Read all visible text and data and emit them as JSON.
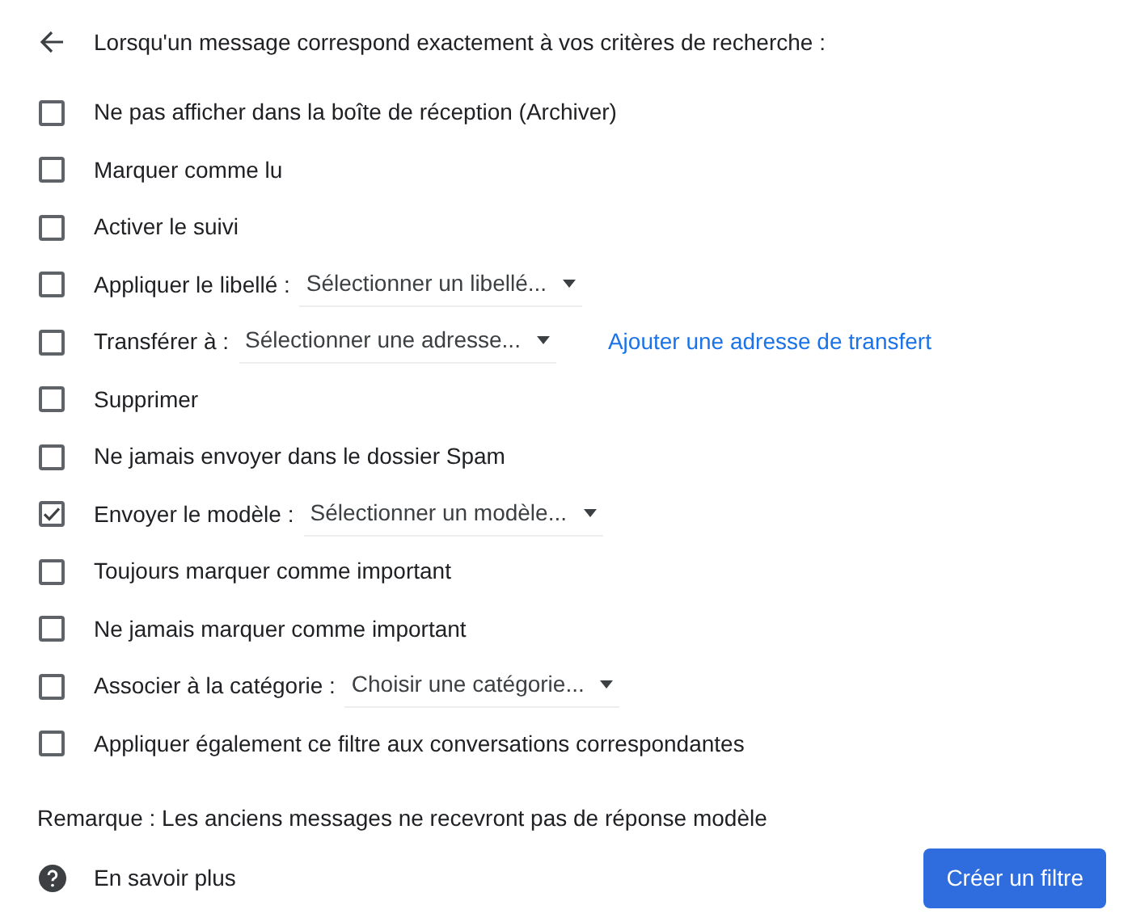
{
  "header": {
    "title": "Lorsqu'un message correspond exactement à vos critères de recherche :"
  },
  "options": [
    {
      "label": "Ne pas afficher dans la boîte de réception (Archiver)",
      "checked": false
    },
    {
      "label": "Marquer comme lu",
      "checked": false
    },
    {
      "label": "Activer le suivi",
      "checked": false
    },
    {
      "label": "Appliquer le libellé :",
      "checked": false,
      "dropdown": "Sélectionner un libellé..."
    },
    {
      "label": "Transférer à :",
      "checked": false,
      "dropdown": "Sélectionner une adresse...",
      "link": "Ajouter une adresse de transfert"
    },
    {
      "label": "Supprimer",
      "checked": false
    },
    {
      "label": "Ne jamais envoyer dans le dossier Spam",
      "checked": false
    },
    {
      "label": "Envoyer le modèle :",
      "checked": true,
      "dropdown": "Sélectionner un modèle..."
    },
    {
      "label": "Toujours marquer comme important",
      "checked": false
    },
    {
      "label": "Ne jamais marquer comme important",
      "checked": false
    },
    {
      "label": "Associer à la catégorie :",
      "checked": false,
      "dropdown": "Choisir une catégorie..."
    },
    {
      "label": "Appliquer également ce filtre aux conversations correspondantes",
      "checked": false
    }
  ],
  "note": "Remarque : Les anciens messages ne recevront pas de réponse modèle",
  "footer": {
    "help_link": "En savoir plus",
    "button": "Créer un filtre"
  }
}
